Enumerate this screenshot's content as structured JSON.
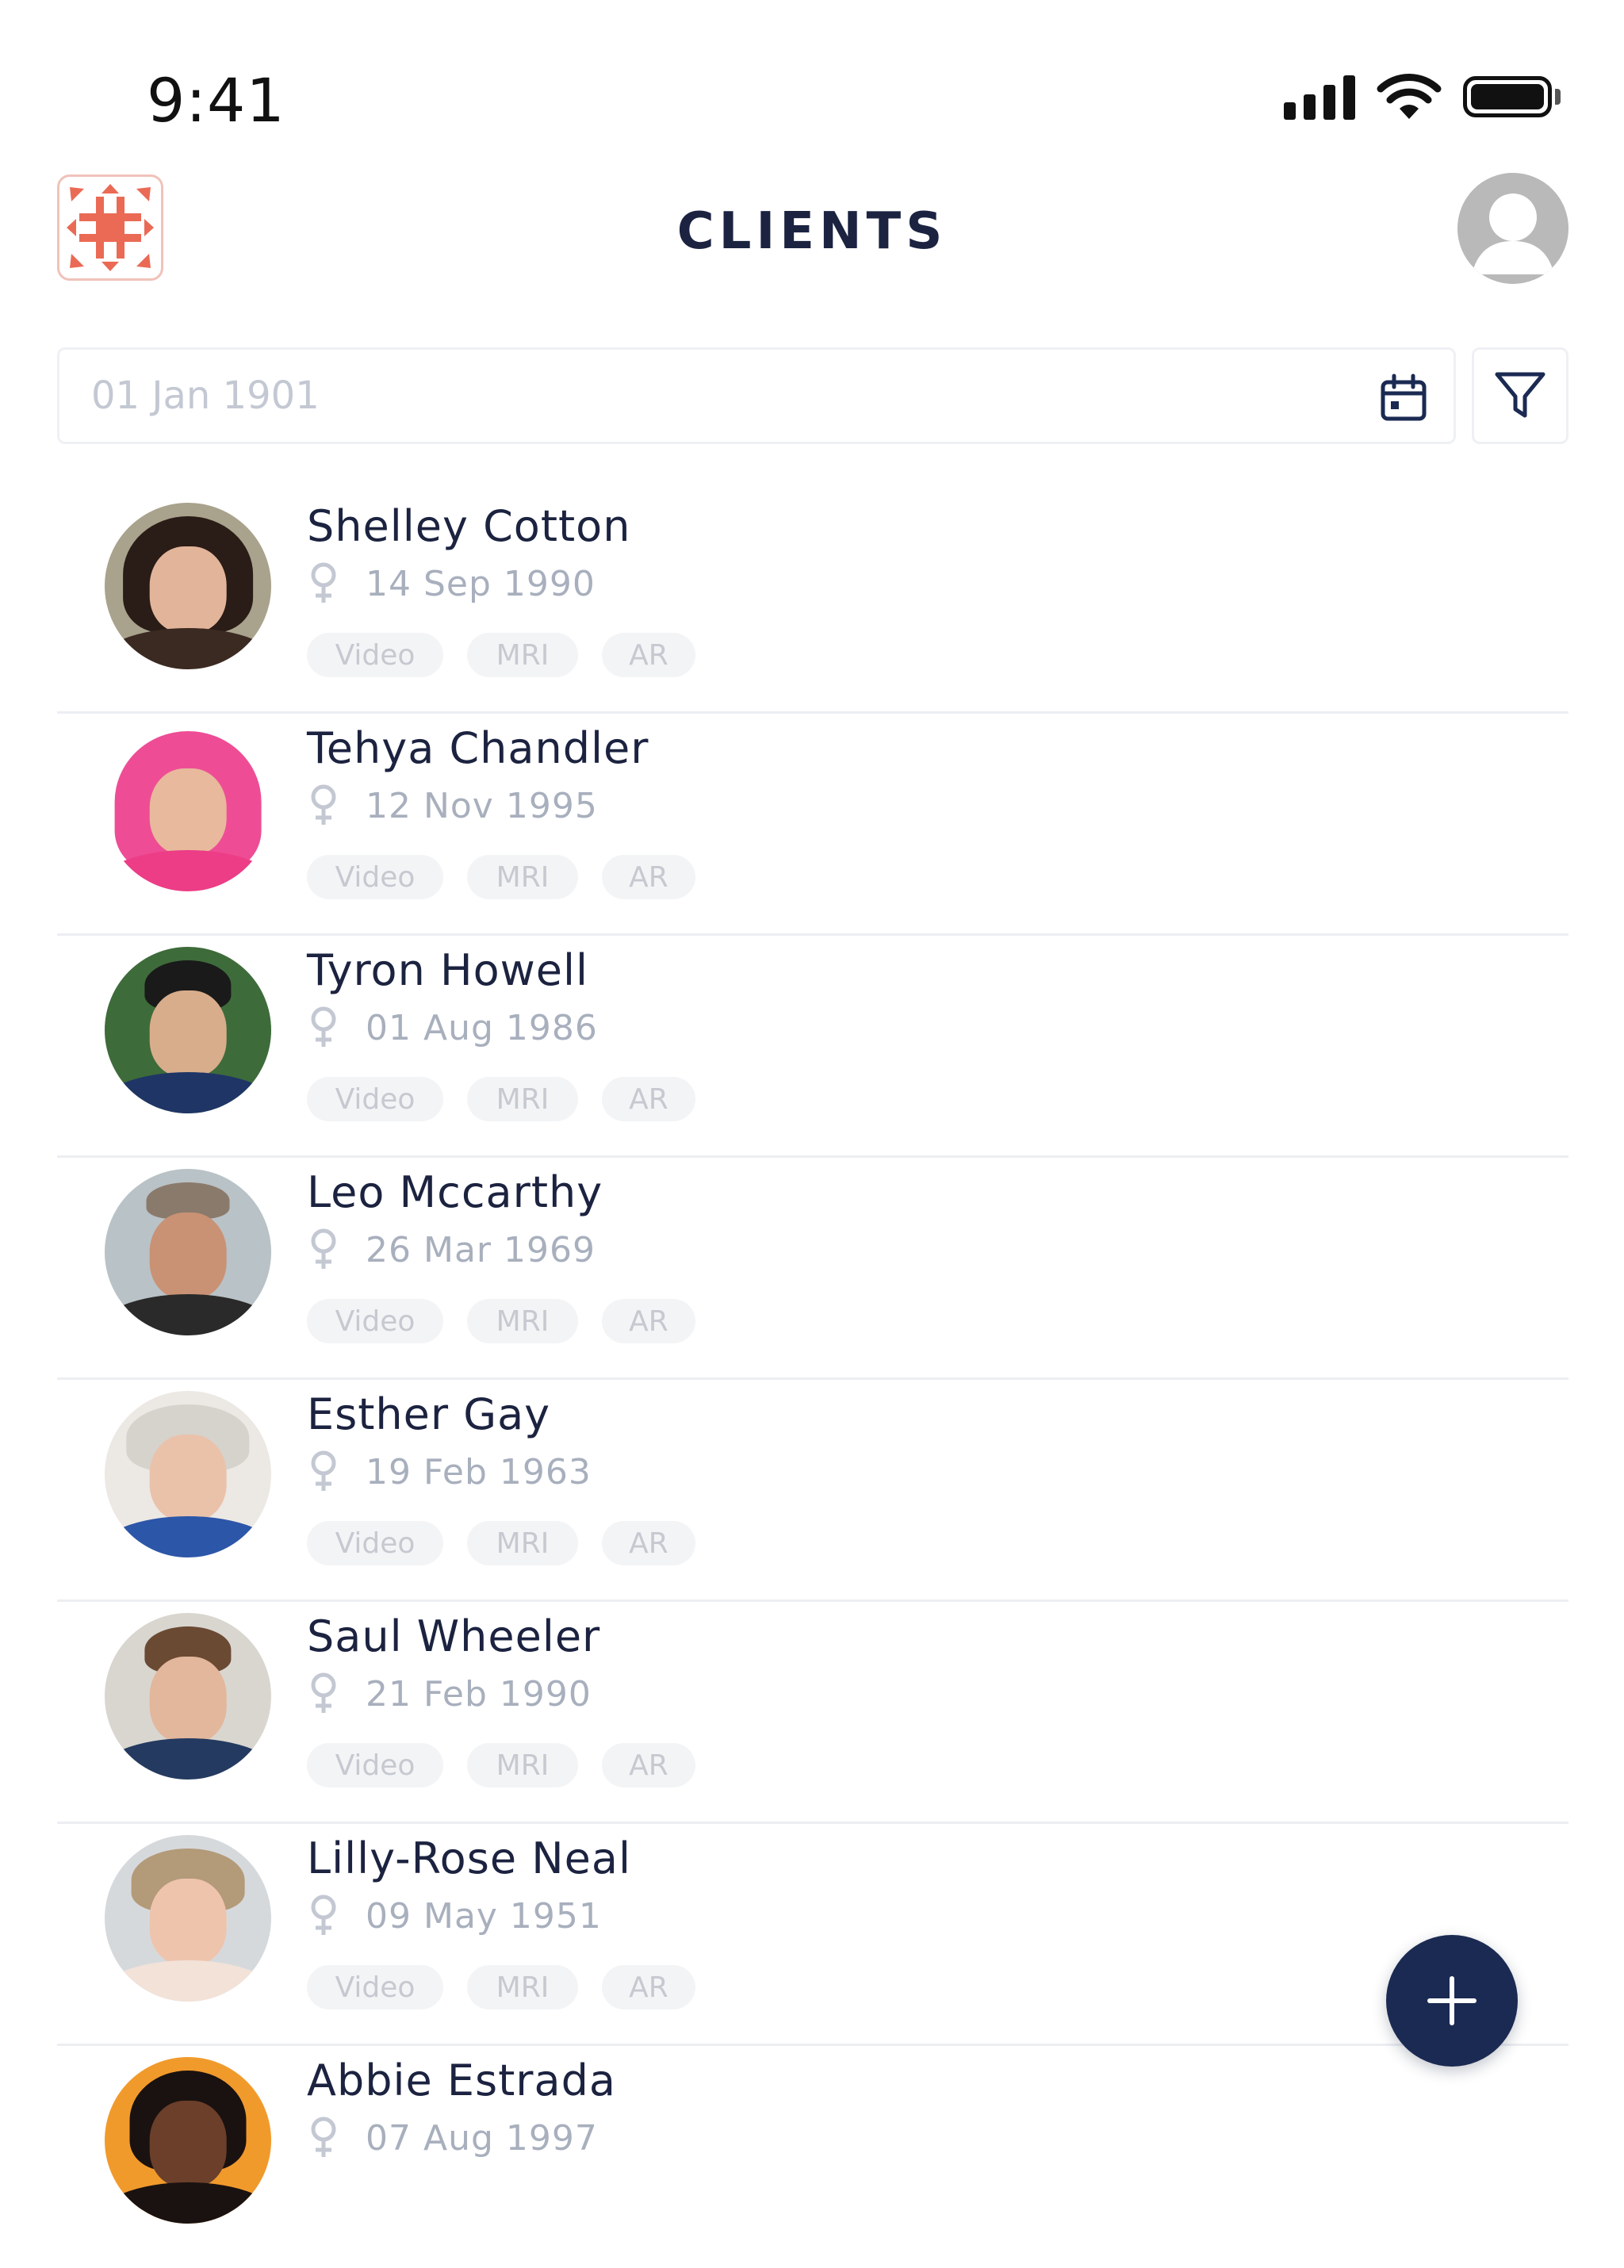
{
  "status_bar": {
    "time": "9:41"
  },
  "header": {
    "title": "CLIENTS"
  },
  "search": {
    "date_placeholder": "01 Jan 1901"
  },
  "tags": {
    "video": "Video",
    "mri": "MRI",
    "ar": "AR"
  },
  "colors": {
    "accent": "#1b2a52",
    "logo": "#ea6a55",
    "muted": "#a8afbd"
  },
  "icons": {
    "calendar": "calendar-icon",
    "filter": "filter-icon",
    "female": "female-icon",
    "add": "plus-icon"
  },
  "clients": [
    {
      "name": "Shelley Cotton",
      "dob": "14 Sep 1990"
    },
    {
      "name": "Tehya Chandler",
      "dob": "12 Nov 1995"
    },
    {
      "name": "Tyron Howell",
      "dob": "01 Aug 1986"
    },
    {
      "name": "Leo Mccarthy",
      "dob": "26 Mar 1969"
    },
    {
      "name": "Esther Gay",
      "dob": "19 Feb 1963"
    },
    {
      "name": "Saul Wheeler",
      "dob": "21 Feb 1990"
    },
    {
      "name": "Lilly-Rose Neal",
      "dob": "09 May 1951"
    },
    {
      "name": "Abbie Estrada",
      "dob": "07 Aug 1997"
    }
  ]
}
